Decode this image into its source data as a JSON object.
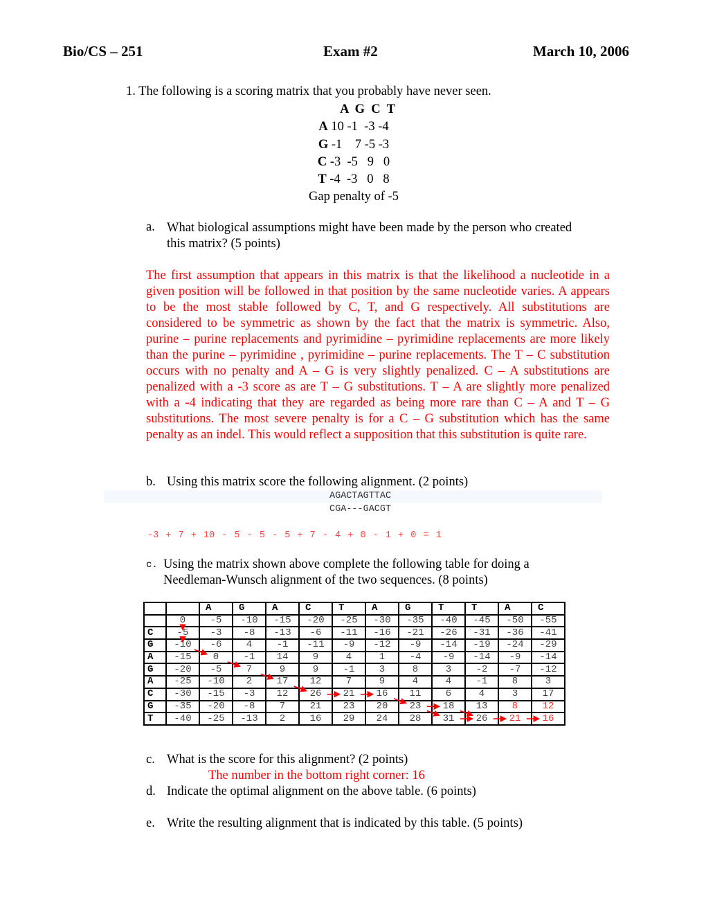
{
  "header": {
    "course": "Bio/CS – 251",
    "exam": "Exam #2",
    "date": "March 10, 2006"
  },
  "q1": {
    "intro": "1.  The following is a scoring matrix that you probably have never seen.",
    "matrix": {
      "col_header": "A  G  C  T",
      "rows": [
        {
          "label": "A",
          "values": "10 -1  -3 -4"
        },
        {
          "label": "G",
          "values": "-1    7 -5 -3"
        },
        {
          "label": "C",
          "values": "-3  -5   9   0"
        },
        {
          "label": "T",
          "values": "-4  -3   0   8"
        }
      ],
      "gap": "Gap penalty of -5"
    },
    "a": {
      "label": "a.",
      "text": "What biological assumptions might have been made by the person who created this matrix?  (5 points)",
      "answer": "The first assumption that appears in this matrix is that the likelihood a nucleotide in a given position will be followed in that position by the same nucleotide varies. A appears to be the most stable followed by C, T, and G respectively.  All substitutions are considered to be symmetric as shown by the fact that the matrix is symmetric.  Also, purine – purine  replacements and pyrimidine – pyrimidine replacements are more likely than the purine – pyrimidine , pyrimidine – purine replacements.  The T – C substitution occurs with no penalty and A – G is very slightly penalized.   C – A substitutions are penalized with a -3 score as are T – G substitutions.  T – A are slightly more penalized with a -4 indicating that they are regarded as being more rare than C – A and T – G substitutions.  The most severe penalty is for a C – G substitution which has the same penalty as an indel.  This would reflect a supposition that this substitution is quite rare."
    },
    "b": {
      "label": "b.",
      "text": "Using this matrix score the following alignment. (2 points)",
      "seq1": "AGACTAGTTAC",
      "seq2": "CGA---GACGT",
      "answer": "-3 + 7 + 10 - 5 - 5 - 5 + 7 - 4 + 0 - 1 + 0 = 1"
    },
    "c": {
      "label": "c.",
      "text": "Using the matrix shown above complete the following table for doing a Needleman-Wunsch alignment of the two sequences.  (8 points)"
    },
    "table": {
      "col_labels": [
        "",
        "",
        "A",
        "G",
        "A",
        "C",
        "T",
        "A",
        "G",
        "T",
        "T",
        "A",
        "C"
      ],
      "rows": [
        {
          "label": "",
          "values": [
            "0",
            "-5",
            "-10",
            "-15",
            "-20",
            "-25",
            "-30",
            "-35",
            "-40",
            "-45",
            "-50",
            "-55"
          ]
        },
        {
          "label": "C",
          "values": [
            "-5",
            "-3",
            "-8",
            "-13",
            "-6",
            "-11",
            "-16",
            "-21",
            "-26",
            "-31",
            "-36",
            "-41"
          ]
        },
        {
          "label": "G",
          "values": [
            "-10",
            "-6",
            "4",
            "-1",
            "-11",
            "-9",
            "-12",
            "-9",
            "-14",
            "-19",
            "-24",
            "-29"
          ]
        },
        {
          "label": "A",
          "values": [
            "-15",
            "0",
            "-1",
            "14",
            "9",
            "4",
            "1",
            "-4",
            "-9",
            "-14",
            "-9",
            "-14"
          ]
        },
        {
          "label": "G",
          "values": [
            "-20",
            "-5",
            "7",
            "9",
            "9",
            "-1",
            "3",
            "8",
            "3",
            "-2",
            "-7",
            "-12"
          ]
        },
        {
          "label": "A",
          "values": [
            "-25",
            "-10",
            "2",
            "17",
            "12",
            "7",
            "9",
            "4",
            "4",
            "-1",
            "8",
            "3"
          ]
        },
        {
          "label": "C",
          "values": [
            "-30",
            "-15",
            "-3",
            "12",
            "26",
            "21",
            "16",
            "11",
            "6",
            "4",
            "3",
            "17"
          ]
        },
        {
          "label": "G",
          "values": [
            "-35",
            "-20",
            "-8",
            "7",
            "21",
            "23",
            "20",
            "23",
            "18",
            "13",
            "8",
            "12"
          ]
        },
        {
          "label": "T",
          "values": [
            "-40",
            "-25",
            "-13",
            "2",
            "16",
            "29",
            "24",
            "28",
            "31",
            "26",
            "21",
            "16"
          ]
        }
      ],
      "red_cells": [
        [
          7,
          10
        ],
        [
          7,
          11
        ],
        [
          8,
          10
        ],
        [
          8,
          11
        ]
      ],
      "traceback_arrows": [
        [
          [
            0,
            0
          ],
          [
            1,
            0
          ]
        ],
        [
          [
            1,
            0
          ],
          [
            2,
            0
          ]
        ],
        [
          [
            2,
            0
          ],
          [
            3,
            1
          ]
        ],
        [
          [
            3,
            1
          ],
          [
            4,
            2
          ]
        ],
        [
          [
            4,
            2
          ],
          [
            5,
            3
          ]
        ],
        [
          [
            5,
            3
          ],
          [
            6,
            4
          ]
        ],
        [
          [
            6,
            4
          ],
          [
            6,
            5
          ]
        ],
        [
          [
            6,
            5
          ],
          [
            6,
            6
          ]
        ],
        [
          [
            6,
            6
          ],
          [
            7,
            7
          ]
        ],
        [
          [
            7,
            7
          ],
          [
            7,
            8
          ]
        ],
        [
          [
            7,
            7
          ],
          [
            8,
            8
          ]
        ],
        [
          [
            7,
            8
          ],
          [
            8,
            9
          ]
        ],
        [
          [
            8,
            8
          ],
          [
            8,
            9
          ]
        ],
        [
          [
            8,
            9
          ],
          [
            8,
            10
          ]
        ],
        [
          [
            8,
            10
          ],
          [
            8,
            11
          ]
        ]
      ],
      "arrow_color": "#ff0000"
    },
    "c2": {
      "label": "c.",
      "text": "What is the score for this alignment? (2 points)",
      "answer": "The number in the bottom right corner: 16"
    },
    "d": {
      "label": "d.",
      "text": "Indicate the optimal alignment on the above table. (6 points)"
    },
    "e": {
      "label": "e.",
      "text": "Write the resulting alignment that is indicated by this table. (5 points)"
    }
  }
}
